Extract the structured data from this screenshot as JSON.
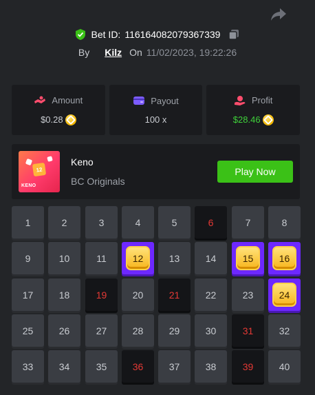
{
  "header": {
    "bet_id_label": "Bet ID:",
    "bet_id": "116164082079367339",
    "by_label": "By",
    "user": "Kilz",
    "on_label": "On",
    "date": "11/02/2023, 19:22:26"
  },
  "stats": {
    "amount": {
      "label": "Amount",
      "value": "$0.28"
    },
    "payout": {
      "label": "Payout",
      "value": "100 x"
    },
    "profit": {
      "label": "Profit",
      "value": "$28.46"
    }
  },
  "game": {
    "name": "Keno",
    "provider": "BC Originals",
    "play_label": "Play Now",
    "thumb_label": "KENO",
    "thumb_card": "12"
  },
  "colors": {
    "accent_green": "#3bc117",
    "hit_purple": "#6d28ff",
    "miss_red": "#e53935",
    "profit_green": "#3fd13a"
  },
  "board": {
    "cells": [
      {
        "n": "1",
        "s": "normal"
      },
      {
        "n": "2",
        "s": "normal"
      },
      {
        "n": "3",
        "s": "normal"
      },
      {
        "n": "4",
        "s": "normal"
      },
      {
        "n": "5",
        "s": "normal"
      },
      {
        "n": "6",
        "s": "miss"
      },
      {
        "n": "7",
        "s": "normal"
      },
      {
        "n": "8",
        "s": "normal"
      },
      {
        "n": "9",
        "s": "normal"
      },
      {
        "n": "10",
        "s": "normal"
      },
      {
        "n": "11",
        "s": "normal"
      },
      {
        "n": "12",
        "s": "hit"
      },
      {
        "n": "13",
        "s": "normal"
      },
      {
        "n": "14",
        "s": "normal"
      },
      {
        "n": "15",
        "s": "hit"
      },
      {
        "n": "16",
        "s": "hit"
      },
      {
        "n": "17",
        "s": "normal"
      },
      {
        "n": "18",
        "s": "normal"
      },
      {
        "n": "19",
        "s": "miss"
      },
      {
        "n": "20",
        "s": "normal"
      },
      {
        "n": "21",
        "s": "miss"
      },
      {
        "n": "22",
        "s": "normal"
      },
      {
        "n": "23",
        "s": "normal"
      },
      {
        "n": "24",
        "s": "hit"
      },
      {
        "n": "25",
        "s": "normal"
      },
      {
        "n": "26",
        "s": "normal"
      },
      {
        "n": "27",
        "s": "normal"
      },
      {
        "n": "28",
        "s": "normal"
      },
      {
        "n": "29",
        "s": "normal"
      },
      {
        "n": "30",
        "s": "normal"
      },
      {
        "n": "31",
        "s": "miss"
      },
      {
        "n": "32",
        "s": "normal"
      },
      {
        "n": "33",
        "s": "normal"
      },
      {
        "n": "34",
        "s": "normal"
      },
      {
        "n": "35",
        "s": "normal"
      },
      {
        "n": "36",
        "s": "miss"
      },
      {
        "n": "37",
        "s": "normal"
      },
      {
        "n": "38",
        "s": "normal"
      },
      {
        "n": "39",
        "s": "miss"
      },
      {
        "n": "40",
        "s": "normal"
      }
    ]
  }
}
